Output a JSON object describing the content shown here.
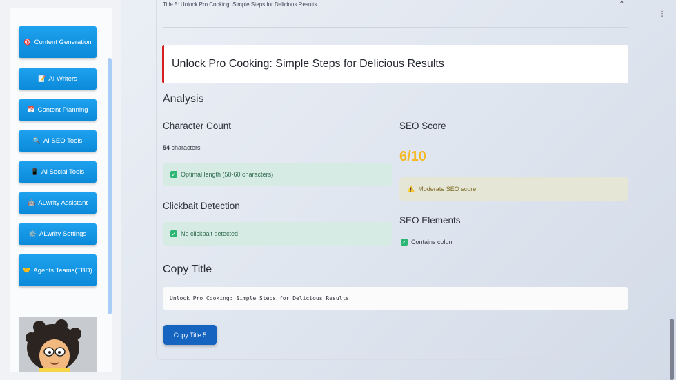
{
  "sidebar": {
    "items": [
      {
        "icon": "🎯",
        "label": "Content Generation"
      },
      {
        "icon": "📝",
        "label": "AI Writers"
      },
      {
        "icon": "📅",
        "label": "Content Planning"
      },
      {
        "icon": "🔍",
        "label": "AI SEO Tools"
      },
      {
        "icon": "📱",
        "label": "AI Social Tools"
      },
      {
        "icon": "🤖",
        "label": "ALwrity Assistant"
      },
      {
        "icon": "⚙️",
        "label": "ALwrity Settings"
      },
      {
        "icon": "🤝",
        "label": "Agents Teams(TBD)"
      }
    ]
  },
  "expander": {
    "title": "Title 5: Unlock Pro Cooking: Simple Steps for Delicious Results",
    "chevron": "^"
  },
  "main": {
    "headline": "Unlock Pro Cooking: Simple Steps for Delicious Results",
    "analysis_heading": "Analysis",
    "char_count_heading": "Character Count",
    "char_count_value": "54",
    "char_count_unit": "characters",
    "char_count_status": "Optimal length (50-60 characters)",
    "clickbait_heading": "Clickbait Detection",
    "clickbait_status": "No clickbait detected",
    "seo_score_heading": "SEO Score",
    "seo_score_value": "6/10",
    "seo_score_status": "Moderate SEO score",
    "seo_elements_heading": "SEO Elements",
    "seo_elements_item": "Contains colon",
    "copy_heading": "Copy Title",
    "copy_text": "Unlock Pro Cooking: Simple Steps for Delicious Results",
    "copy_button": "Copy Title 5"
  },
  "colors": {
    "accent_red": "#d61f1f",
    "score_yellow": "#f5b828",
    "button_blue": "#1565c0",
    "nav_blue": "#0b8ad9",
    "success_green": "#2bb673"
  }
}
